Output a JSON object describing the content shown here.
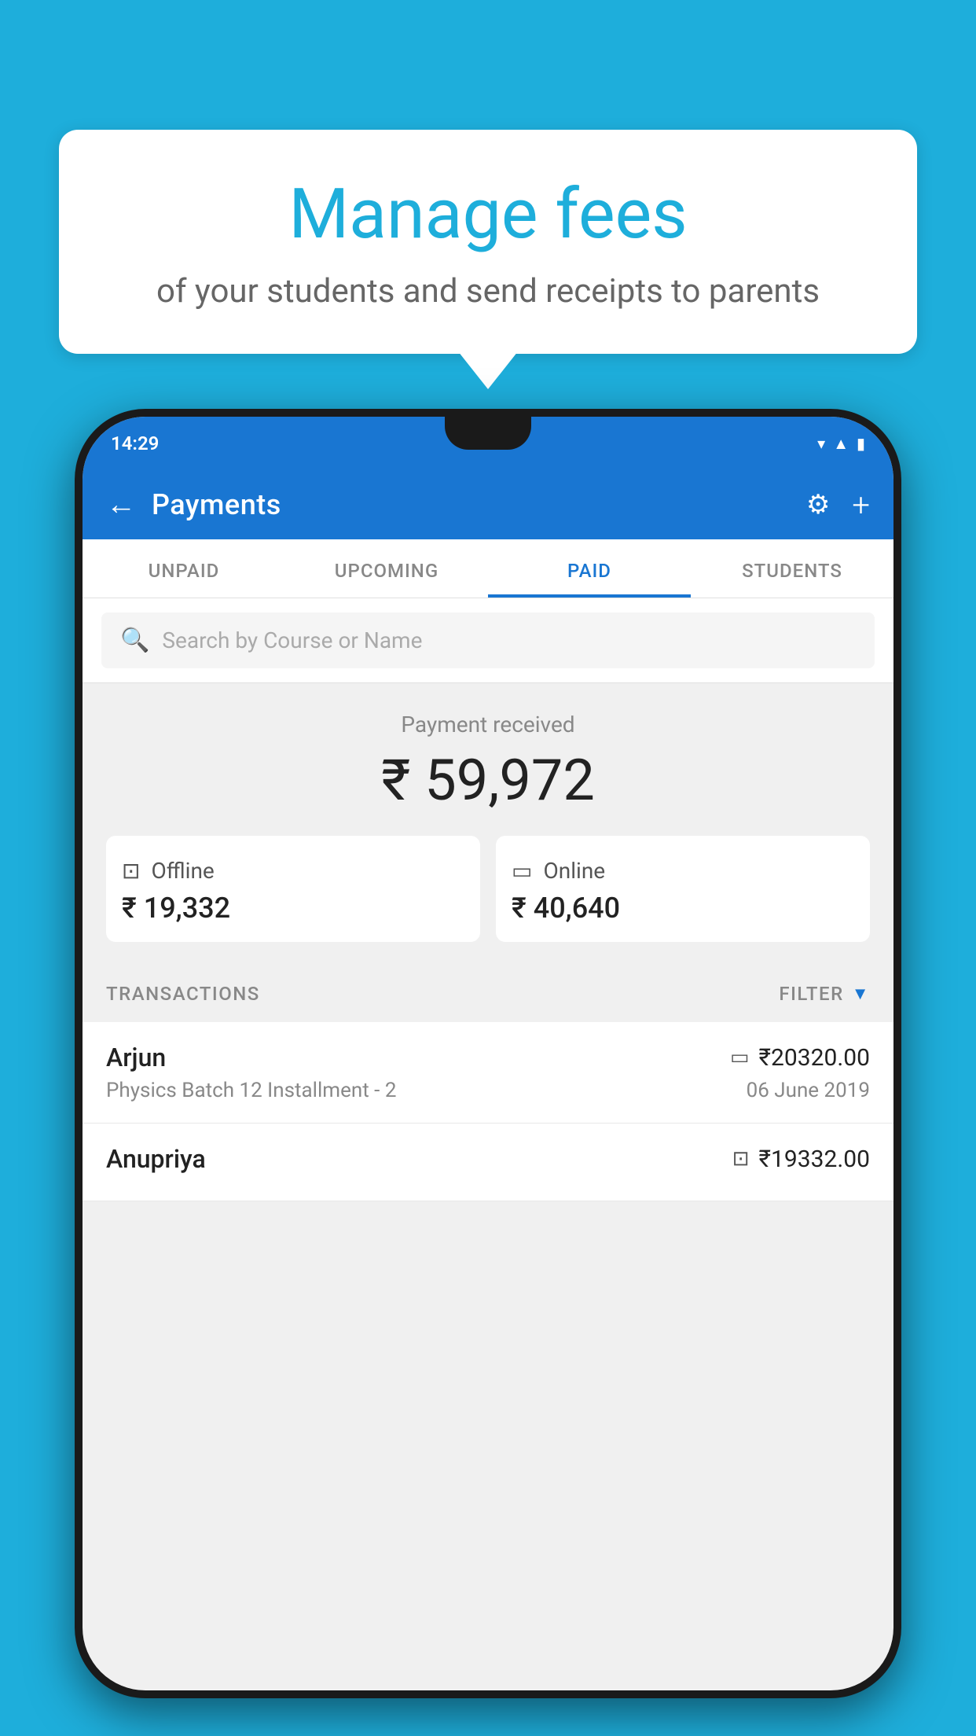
{
  "background_color": "#1EAEDB",
  "speech_bubble": {
    "title": "Manage fees",
    "subtitle": "of your students and send receipts to parents"
  },
  "phone": {
    "status_bar": {
      "time": "14:29",
      "icons": [
        "wifi",
        "signal",
        "battery"
      ]
    },
    "app_bar": {
      "title": "Payments",
      "back_label": "←",
      "settings_label": "⚙",
      "add_label": "+"
    },
    "tabs": [
      {
        "label": "UNPAID",
        "active": false
      },
      {
        "label": "UPCOMING",
        "active": false
      },
      {
        "label": "PAID",
        "active": true
      },
      {
        "label": "STUDENTS",
        "active": false
      }
    ],
    "search": {
      "placeholder": "Search by Course or Name"
    },
    "payment_received": {
      "label": "Payment received",
      "total": "₹ 59,972",
      "offline": {
        "type": "Offline",
        "amount": "₹ 19,332"
      },
      "online": {
        "type": "Online",
        "amount": "₹ 40,640"
      }
    },
    "transactions": {
      "header": "TRANSACTIONS",
      "filter_label": "FILTER",
      "rows": [
        {
          "name": "Arjun",
          "course": "Physics Batch 12 Installment - 2",
          "amount": "₹20320.00",
          "date": "06 June 2019",
          "payment_type": "card"
        },
        {
          "name": "Anupriya",
          "course": "",
          "amount": "₹19332.00",
          "date": "",
          "payment_type": "offline"
        }
      ]
    }
  }
}
